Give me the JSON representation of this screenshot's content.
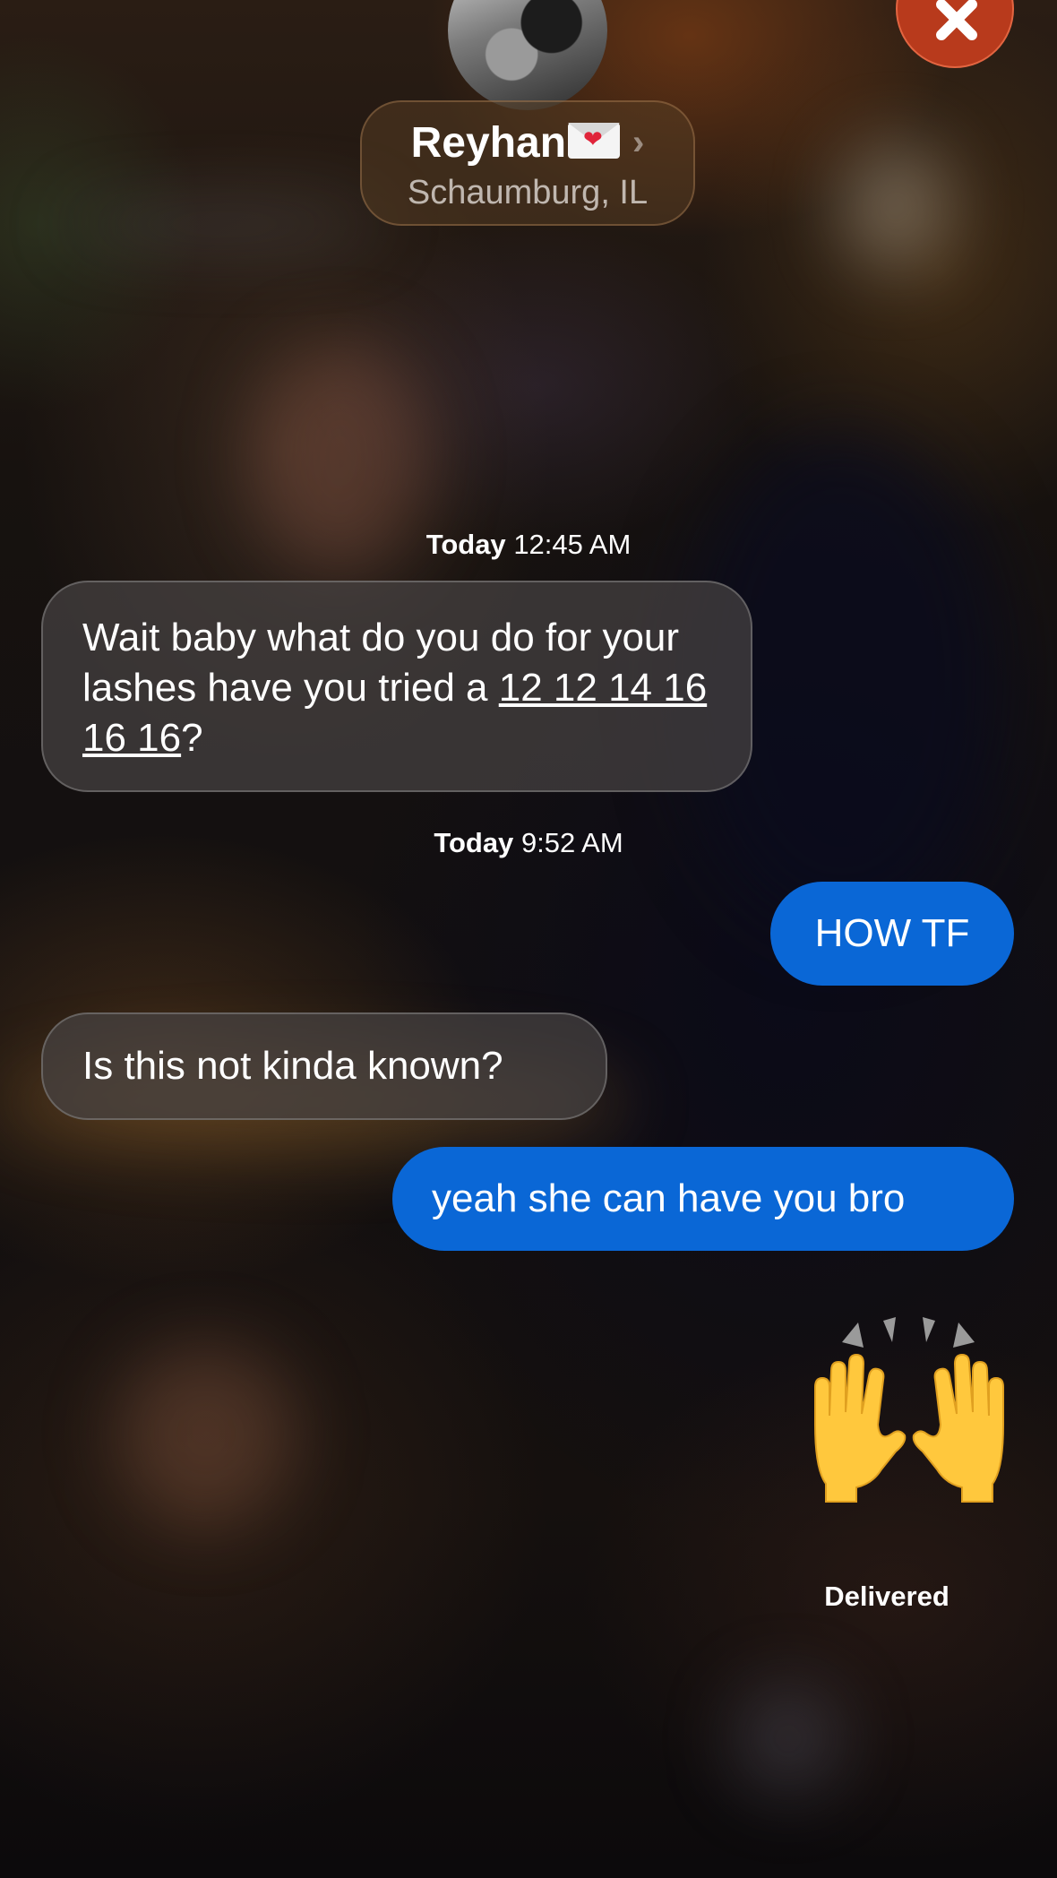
{
  "header": {
    "contact_name": "Reyhan",
    "contact_location": "Schaumburg, IL",
    "chevron": "›"
  },
  "conversation": {
    "timestamps": [
      {
        "day": "Today",
        "time": "12:45 AM"
      },
      {
        "day": "Today",
        "time": "9:52 AM"
      }
    ],
    "messages": [
      {
        "direction": "received",
        "text_before_link": "Wait baby what do you do for your lashes have you tried a ",
        "link_text": "12 12 14 16 16 16",
        "text_after_link": "?"
      },
      {
        "direction": "sent",
        "text": "HOW TF"
      },
      {
        "direction": "received",
        "text": "Is this not kinda known?"
      },
      {
        "direction": "sent",
        "text": "yeah she can have you bro"
      },
      {
        "direction": "sent",
        "emoji": "raised-hands"
      }
    ],
    "status": "Delivered"
  },
  "icons": {
    "close": "close-icon",
    "envelope": "envelope-heart-icon",
    "chevron": "chevron-right-icon",
    "emoji": "raised-hands-emoji"
  },
  "colors": {
    "sent_bubble": "#0a67d6",
    "received_bubble": "#464242",
    "close_button": "#b83a1c"
  }
}
